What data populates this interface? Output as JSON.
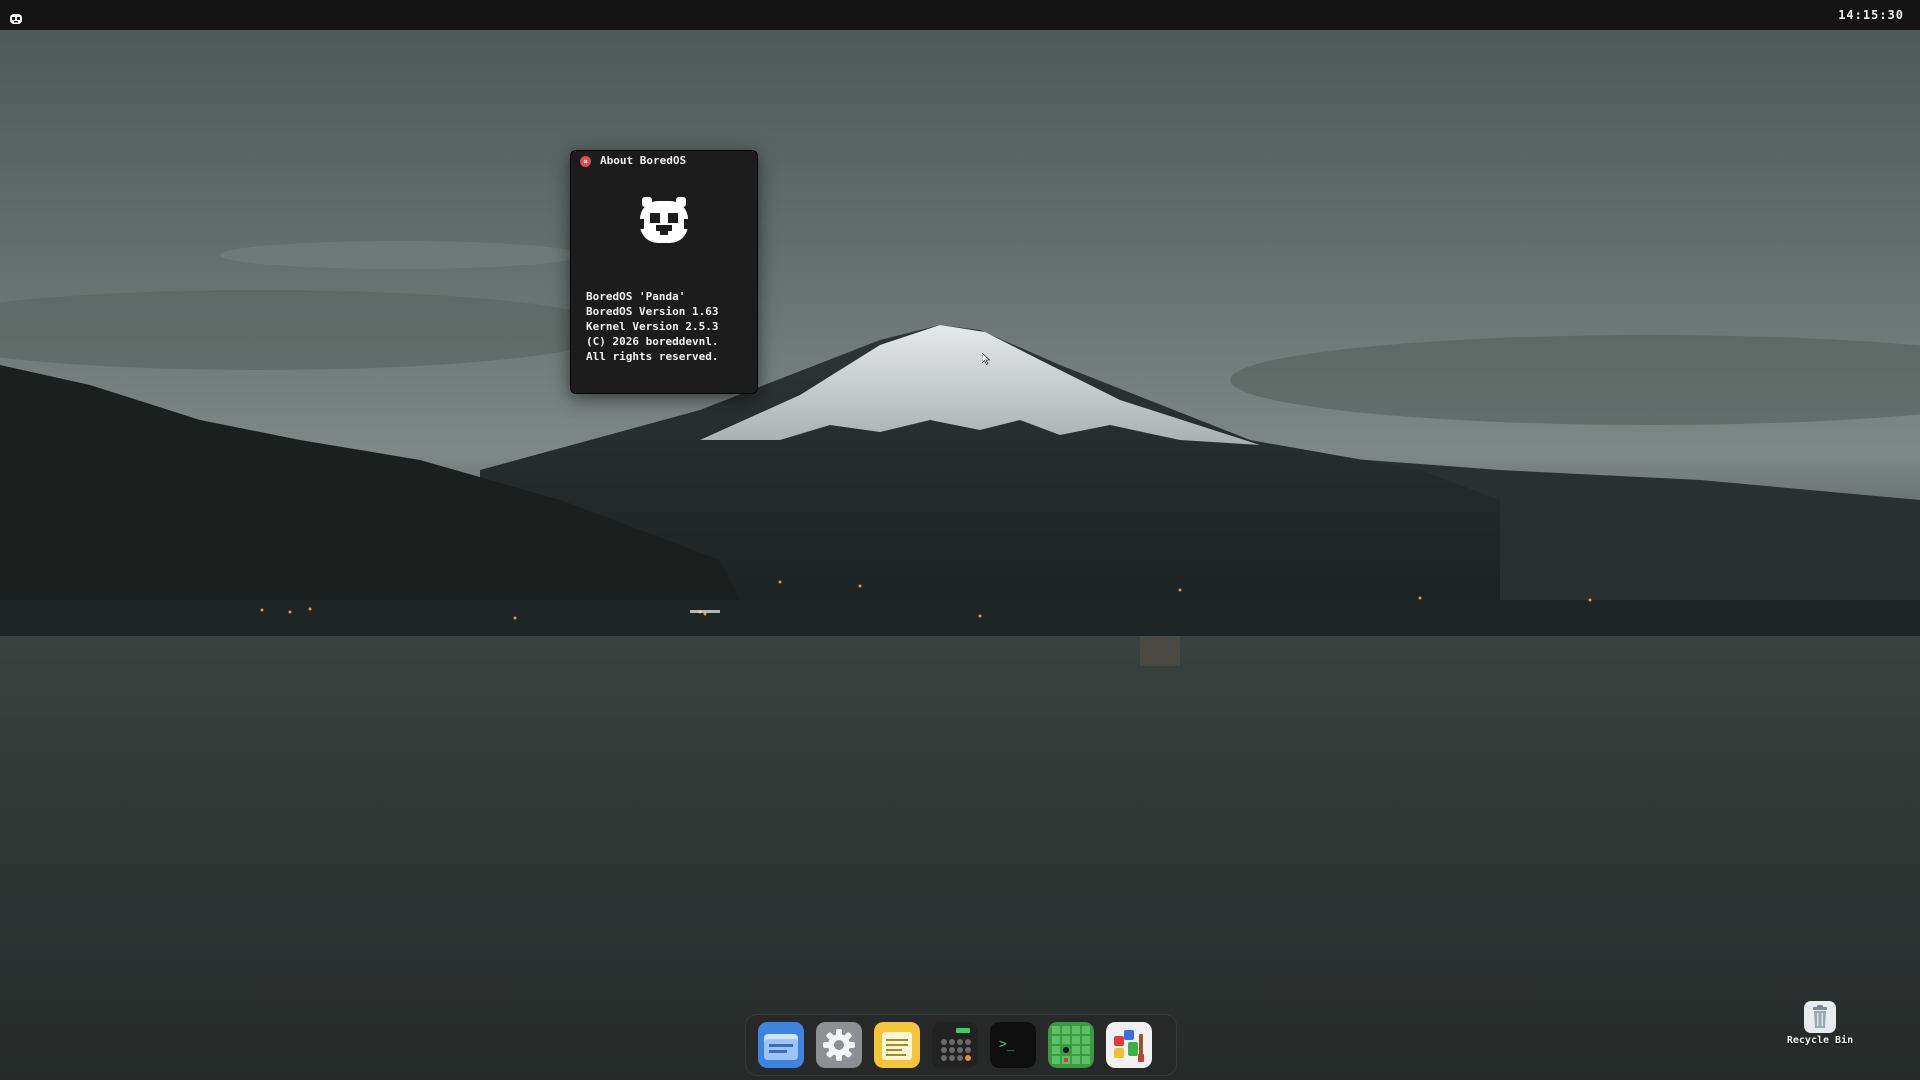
{
  "topbar": {
    "logo_icon": "panda-icon",
    "clock": "14:15:30"
  },
  "about_window": {
    "title": "About BoredOS",
    "close_icon": "close-icon",
    "logo_icon": "panda-icon",
    "lines": [
      "BoredOS 'Panda'",
      "BoredOS Version 1.63",
      "Kernel Version 2.5.3",
      "(C) 2026 boreddevnl.",
      "All rights reserved."
    ]
  },
  "dock": {
    "items": [
      {
        "name": "files",
        "icon": "folder-icon"
      },
      {
        "name": "settings",
        "icon": "gear-icon"
      },
      {
        "name": "notes",
        "icon": "notes-icon"
      },
      {
        "name": "calculator",
        "icon": "calculator-icon"
      },
      {
        "name": "terminal",
        "icon": "terminal-icon",
        "prompt": ">_"
      },
      {
        "name": "minesweeper",
        "icon": "grid-game-icon"
      },
      {
        "name": "paint",
        "icon": "paint-icon"
      }
    ]
  },
  "desktop_icons": {
    "recycle_bin": {
      "label": "Recycle Bin",
      "icon": "trash-icon"
    }
  },
  "colors": {
    "topbar": "#141414",
    "window_bg": "#1c1c1c",
    "close_button": "#e24a4a",
    "dock_bg": "#282828"
  }
}
